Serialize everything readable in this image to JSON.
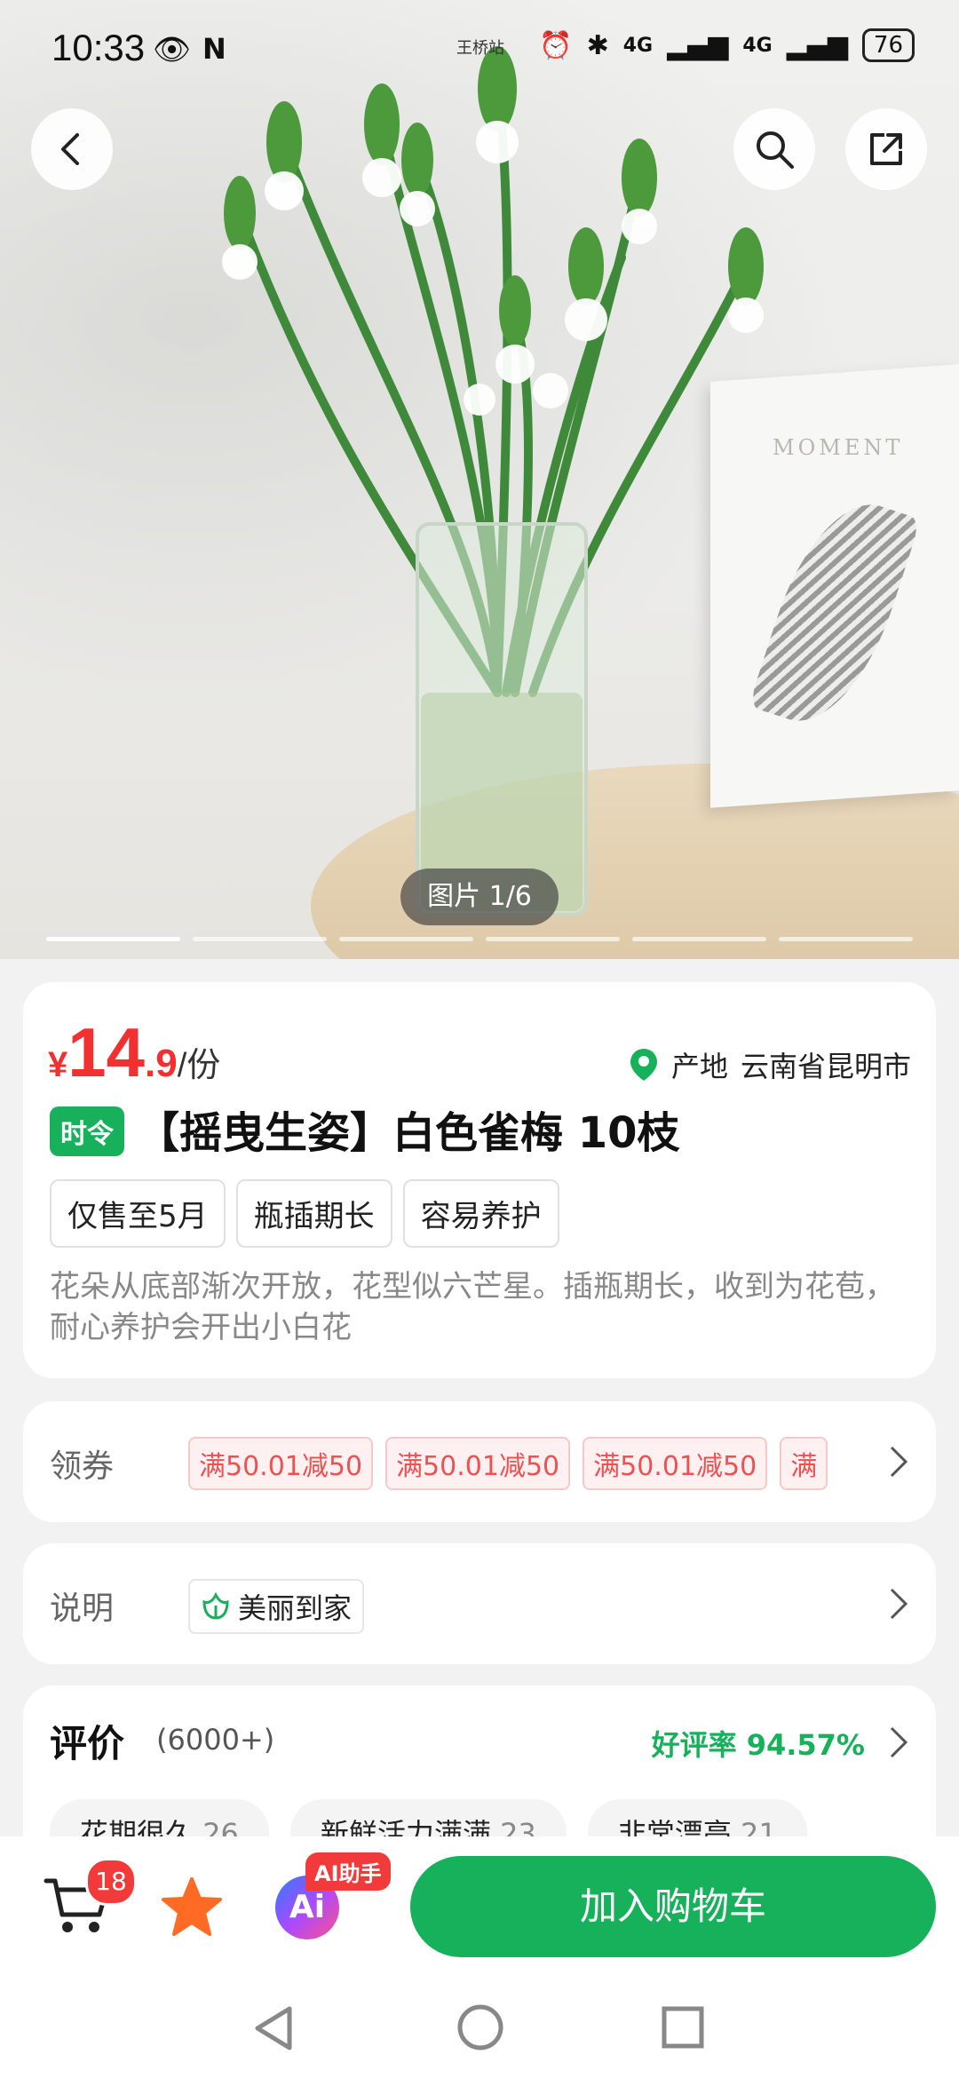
{
  "status_bar": {
    "time": "10:33",
    "carrier": "王桥站",
    "signal_1": "4G",
    "signal_2": "4G",
    "battery": "76"
  },
  "gallery": {
    "counter": "图片 1/6",
    "active_index": 1,
    "total": 6,
    "book_text": "MOMENT"
  },
  "product": {
    "currency": "¥",
    "price_int": "14",
    "price_dec": ".9",
    "unit": "/份",
    "origin_label": "产地",
    "origin_value": "云南省昆明市",
    "season_tag": "时令",
    "title": "【摇曳生姿】白色雀梅 10枝",
    "chips": [
      "仅售至5月",
      "瓶插期长",
      "容易养护"
    ],
    "description": "花朵从底部渐次开放，花型似六芒星。插瓶期长，收到为花苞，耐心养护会开出小白花"
  },
  "coupons": {
    "label": "领券",
    "items": [
      "满50.01减50",
      "满50.01减50",
      "满50.01减50",
      "满"
    ]
  },
  "info": {
    "label": "说明",
    "badge": "美丽到家"
  },
  "reviews": {
    "title": "评价",
    "count": "(6000+)",
    "rating": "好评率 94.57%",
    "tags": [
      {
        "text": "花期很久",
        "count": "26"
      },
      {
        "text": "新鲜活力满满",
        "count": "23"
      },
      {
        "text": "非常漂亮",
        "count": "21"
      }
    ]
  },
  "bottom_bar": {
    "cart_count": "18",
    "ai_badge": "AI助手",
    "ai_label": "Ai",
    "add_to_cart": "加入购物车"
  },
  "colors": {
    "brand_green": "#16b15a",
    "price_red": "#f23030"
  }
}
